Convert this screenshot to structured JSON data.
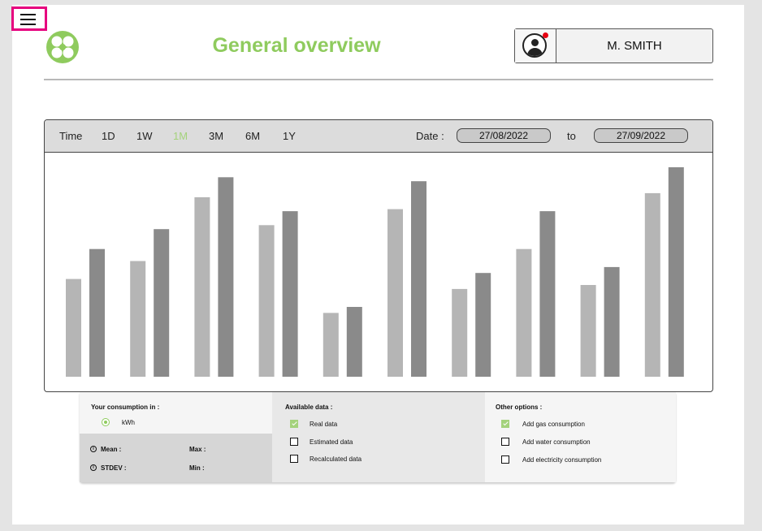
{
  "header": {
    "title": "General overview",
    "user_name": "M. SMITH"
  },
  "toolbar": {
    "time_label": "Time",
    "ranges": [
      "1D",
      "1W",
      "1M",
      "3M",
      "6M",
      "1Y"
    ],
    "active_range": "1M",
    "date_label": "Date :",
    "date_from": "27/08/2022",
    "to_label": "to",
    "date_to": "27/09/2022"
  },
  "chart_data": {
    "type": "bar",
    "categories": [
      "",
      "",
      "",
      "",
      "",
      "",
      "",
      "",
      "",
      ""
    ],
    "series": [
      {
        "values": [
          49,
          58,
          90,
          76,
          32,
          84,
          44,
          64,
          46,
          92
        ]
      },
      {
        "values": [
          64,
          74,
          100,
          83,
          35,
          98,
          52,
          83,
          55,
          105
        ]
      }
    ],
    "colors": [
      "#b5b5b5",
      "#8a8a8a"
    ],
    "grid": false,
    "axes_visible": false
  },
  "options": {
    "consumption": {
      "title": "Your consumption in :",
      "unit": "kWh",
      "mean_label": "Mean :",
      "max_label": "Max :",
      "stdev_label": "STDEV :",
      "min_label": "Min :"
    },
    "available": {
      "title": "Available data :",
      "items": [
        {
          "label": "Real data",
          "checked": true
        },
        {
          "label": "Estimated data",
          "checked": false
        },
        {
          "label": "Recalculated data",
          "checked": false
        }
      ]
    },
    "other": {
      "title": "Other options :",
      "items": [
        {
          "label": "Add gas consumption",
          "checked": true
        },
        {
          "label": "Add water consumption",
          "checked": false
        },
        {
          "label": "Add electricity consumption",
          "checked": false
        }
      ]
    }
  },
  "icons": {
    "menu": "hamburger-icon",
    "logo": "clover-logo",
    "avatar": "user-avatar-icon",
    "notification": "notification-dot",
    "info": "info-icon"
  },
  "colors": {
    "accent": "#8fcb5e",
    "highlight": "#e6007e",
    "notification": "#e60012"
  }
}
